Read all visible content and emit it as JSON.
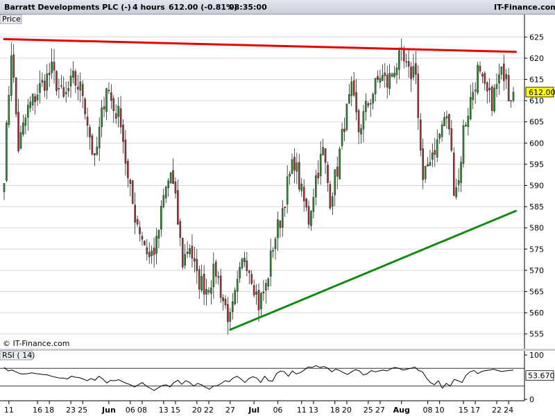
{
  "header": {
    "title": "Barratt Developments PLC (-)",
    "interval": "4 hours",
    "quote": "612.00 (-0.81%)",
    "time": "08:35:00",
    "brand": "IT-Finance.com"
  },
  "price_panel": {
    "label": "Price",
    "watermark": "© IT-Finance.com",
    "last_price_label": "612.00"
  },
  "rsi_panel": {
    "label": "RSI ( 14)",
    "value_label": "53.670"
  },
  "colors": {
    "up": "#2f8f2f",
    "down": "#a43a3a",
    "resistance": "#e60000",
    "support": "#138a13",
    "rsi_line": "#000000",
    "rsi_extreme": "#3a3aa8",
    "grid": "#d8d8d8"
  },
  "chart_data": [
    {
      "type": "candlestick",
      "title": "Barratt Developments PLC (-)",
      "ylim": [
        552,
        628
      ],
      "y_ticks": [
        555,
        560,
        565,
        570,
        575,
        580,
        585,
        590,
        595,
        600,
        605,
        610,
        615,
        620,
        625
      ],
      "x_tick_labels": [
        "11",
        "16",
        "18",
        "23",
        "25",
        "Jun",
        "06",
        "08",
        "13",
        "15",
        "20",
        "22",
        "27",
        "Jul",
        "06",
        "11",
        "13",
        "18",
        "20",
        "25",
        "27",
        "Aug",
        "08",
        "10",
        "15",
        "17",
        "22",
        "24"
      ],
      "x_tick_bars": [
        2,
        14,
        19,
        28,
        33,
        44,
        53,
        58,
        67,
        72,
        81,
        86,
        95,
        105,
        115,
        125,
        130,
        139,
        144,
        153,
        158,
        167,
        178,
        183,
        193,
        198,
        207,
        212
      ],
      "bar_count": 215,
      "anchors": [
        [
          0,
          593
        ],
        [
          3,
          622
        ],
        [
          6,
          599
        ],
        [
          10,
          608
        ],
        [
          15,
          613
        ],
        [
          20,
          617
        ],
        [
          25,
          610
        ],
        [
          29,
          615
        ],
        [
          33,
          612
        ],
        [
          38,
          595
        ],
        [
          43,
          614
        ],
        [
          46,
          608
        ],
        [
          49,
          606
        ],
        [
          52,
          591
        ],
        [
          55,
          583
        ],
        [
          58,
          578
        ],
        [
          61,
          573
        ],
        [
          64,
          576
        ],
        [
          67,
          587
        ],
        [
          70,
          593
        ],
        [
          72,
          586
        ],
        [
          75,
          572
        ],
        [
          78,
          576
        ],
        [
          81,
          568
        ],
        [
          85,
          566
        ],
        [
          89,
          570
        ],
        [
          92,
          563
        ],
        [
          95,
          558
        ],
        [
          98,
          566
        ],
        [
          101,
          574
        ],
        [
          104,
          569
        ],
        [
          107,
          562
        ],
        [
          110,
          566
        ],
        [
          113,
          576
        ],
        [
          116,
          582
        ],
        [
          119,
          590
        ],
        [
          122,
          596
        ],
        [
          125,
          588
        ],
        [
          128,
          582
        ],
        [
          131,
          592
        ],
        [
          134,
          598
        ],
        [
          137,
          587
        ],
        [
          140,
          594
        ],
        [
          143,
          605
        ],
        [
          146,
          612
        ],
        [
          149,
          603
        ],
        [
          152,
          608
        ],
        [
          155,
          612
        ],
        [
          158,
          616
        ],
        [
          161,
          614
        ],
        [
          164,
          618
        ],
        [
          167,
          620
        ],
        [
          170,
          616
        ],
        [
          173,
          618
        ],
        [
          174,
          606
        ],
        [
          176,
          590
        ],
        [
          179,
          597
        ],
        [
          182,
          600
        ],
        [
          185,
          606
        ],
        [
          187,
          604
        ],
        [
          189,
          590
        ],
        [
          191,
          591
        ],
        [
          193,
          603
        ],
        [
          196,
          610
        ],
        [
          199,
          617
        ],
        [
          202,
          612
        ],
        [
          205,
          610
        ],
        [
          208,
          615
        ],
        [
          211,
          618
        ],
        [
          212,
          612
        ]
      ],
      "series": [
        {
          "name": "Price",
          "last": 612.0
        }
      ],
      "trendlines": [
        {
          "name": "resistance",
          "from": [
            0,
            624.5
          ],
          "to": [
            215,
            621.5
          ]
        },
        {
          "name": "support",
          "from": [
            95,
            556
          ],
          "to": [
            215,
            584
          ]
        }
      ]
    },
    {
      "type": "line",
      "title": "RSI ( 14)",
      "ylim": [
        0,
        100
      ],
      "y_ticks": [
        0,
        100
      ],
      "levels": [
        30,
        70
      ],
      "last": 53.67,
      "values": [
        72,
        64,
        66,
        62,
        58,
        57,
        58,
        60,
        58,
        57,
        56,
        55,
        52,
        50,
        48,
        48,
        46,
        52,
        50,
        49,
        46,
        42,
        47,
        43,
        52,
        46,
        37,
        43,
        42,
        44,
        40,
        36,
        33,
        28,
        33,
        38,
        30,
        25,
        20,
        26,
        31,
        33,
        28,
        38,
        43,
        34,
        42,
        38,
        30,
        36,
        33,
        27,
        23,
        30,
        31,
        36,
        42,
        40,
        48,
        52,
        46,
        38,
        47,
        51,
        48,
        38,
        52,
        42,
        41,
        58,
        64,
        62,
        52,
        64,
        57,
        60,
        66,
        73,
        72,
        76,
        72,
        74,
        70,
        62,
        68,
        65,
        60,
        56,
        62,
        67,
        64,
        55,
        58,
        65,
        62,
        64,
        66,
        64,
        69,
        72,
        70,
        66,
        68,
        70,
        73,
        65,
        62,
        48,
        38,
        33,
        42,
        25,
        36,
        30,
        45,
        42,
        38,
        54,
        62,
        65,
        58,
        63,
        65,
        66,
        68,
        65,
        63,
        64,
        65,
        66
      ]
    }
  ]
}
